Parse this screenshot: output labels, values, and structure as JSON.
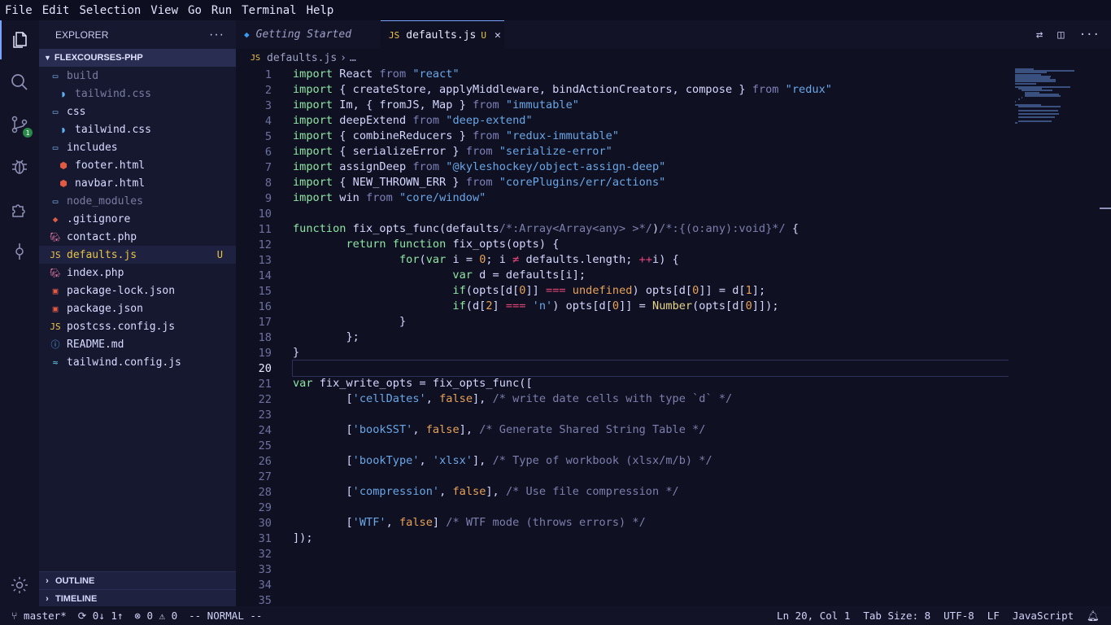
{
  "menu": [
    "File",
    "Edit",
    "Selection",
    "View",
    "Go",
    "Run",
    "Terminal",
    "Help"
  ],
  "activity": {
    "scm_badge": "1"
  },
  "sidebar": {
    "title": "EXPLORER",
    "more": "···",
    "root": "FLEXCOURSES-PHP",
    "items": [
      {
        "label": "build",
        "indent": 1,
        "icon": "folder",
        "dim": true
      },
      {
        "label": "tailwind.css",
        "indent": 2,
        "icon": "css",
        "dim": true
      },
      {
        "label": "css",
        "indent": 1,
        "icon": "folder"
      },
      {
        "label": "tailwind.css",
        "indent": 2,
        "icon": "css"
      },
      {
        "label": "includes",
        "indent": 1,
        "icon": "folder"
      },
      {
        "label": "footer.html",
        "indent": 2,
        "icon": "html"
      },
      {
        "label": "navbar.html",
        "indent": 2,
        "icon": "html"
      },
      {
        "label": "node_modules",
        "indent": 1,
        "icon": "folder",
        "dim": true
      },
      {
        "label": ".gitignore",
        "indent": 1,
        "icon": "git"
      },
      {
        "label": "contact.php",
        "indent": 1,
        "icon": "php"
      },
      {
        "label": "defaults.js",
        "indent": 1,
        "icon": "js",
        "selected": true,
        "status": "U"
      },
      {
        "label": "index.php",
        "indent": 1,
        "icon": "php"
      },
      {
        "label": "package-lock.json",
        "indent": 1,
        "icon": "npm"
      },
      {
        "label": "package.json",
        "indent": 1,
        "icon": "npm"
      },
      {
        "label": "postcss.config.js",
        "indent": 1,
        "icon": "js"
      },
      {
        "label": "README.md",
        "indent": 1,
        "icon": "info"
      },
      {
        "label": "tailwind.config.js",
        "indent": 1,
        "icon": "wind"
      }
    ],
    "outline": "OUTLINE",
    "timeline": "TIMELINE"
  },
  "tabs": [
    {
      "label": "Getting Started",
      "active": false
    },
    {
      "label": "defaults.js",
      "active": true,
      "status": "U"
    }
  ],
  "breadcrumb": {
    "file": "defaults.js",
    "more": "…"
  },
  "code": [
    "import React from \"react\"",
    "import { createStore, applyMiddleware, bindActionCreators, compose } from \"redux\"",
    "import Im, { fromJS, Map } from \"immutable\"",
    "import deepExtend from \"deep-extend\"",
    "import { combineReducers } from \"redux-immutable\"",
    "import { serializeError } from \"serialize-error\"",
    "import assignDeep from \"@kyleshockey/object-assign-deep\"",
    "import { NEW_THROWN_ERR } from \"corePlugins/err/actions\"",
    "import win from \"core/window\"",
    "",
    "function fix_opts_func(defaults/*:Array<Array<any> >*/)/*:{(o:any):void}*/ {",
    "        return function fix_opts(opts) {",
    "                for(var i = 0; i ≠ defaults.length; ++i) {",
    "                        var d = defaults[i];",
    "                        if(opts[d[0]] === undefined) opts[d[0]] = d[1];",
    "                        if(d[2] === 'n') opts[d[0]] = Number(opts[d[0]]);",
    "                }",
    "        };",
    "}",
    "",
    "var fix_write_opts = fix_opts_func([",
    "        ['cellDates', false], /* write date cells with type `d` */",
    "",
    "        ['bookSST', false], /* Generate Shared String Table */",
    "",
    "        ['bookType', 'xlsx'], /* Type of workbook (xlsx/m/b) */",
    "",
    "        ['compression', false], /* Use file compression */",
    "",
    "        ['WTF', false] /* WTF mode (throws errors) */",
    "]);",
    "",
    "",
    "",
    ""
  ],
  "current_line": 20,
  "status": {
    "branch": "master*",
    "sync": "0↓ 1↑",
    "errors": "0",
    "warnings": "0",
    "mode": "-- NORMAL --",
    "position": "Ln 20, Col 1",
    "tab_size": "Tab Size: 8",
    "encoding": "UTF-8",
    "eol": "LF",
    "language": "JavaScript"
  }
}
